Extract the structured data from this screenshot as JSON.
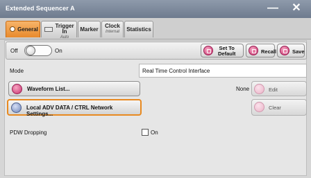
{
  "window": {
    "title": "Extended Sequencer A",
    "minimize_glyph": "—",
    "close_glyph": "✕"
  },
  "tabs": [
    {
      "label": "General",
      "sub": "",
      "active": true
    },
    {
      "label": "Trigger In",
      "sub": "Auto",
      "active": false
    },
    {
      "label": "Marker",
      "sub": "",
      "active": false
    },
    {
      "label": "Clock",
      "sub": "Internal",
      "active": false
    },
    {
      "label": "Statistics",
      "sub": "",
      "active": false
    }
  ],
  "toolbar": {
    "off_label": "Off",
    "on_label": "On",
    "set_default_line1": "Set To",
    "set_default_line2": "Default",
    "recall_label": "Recall",
    "save_label": "Save"
  },
  "mode": {
    "label": "Mode",
    "value": "Real Time Control Interface"
  },
  "waveform": {
    "button_label": "Waveform List...",
    "none_label": "None",
    "edit_label": "Edit"
  },
  "network": {
    "button_label": "Local ADV DATA / CTRL Network Settings...",
    "clear_label": "Clear"
  },
  "pdw": {
    "label": "PDW Dropping",
    "checkbox_label": "On"
  },
  "colors": {
    "accent": "#e8891f",
    "titlebar": "#7b8799",
    "icon_pink": "#c8336f"
  }
}
